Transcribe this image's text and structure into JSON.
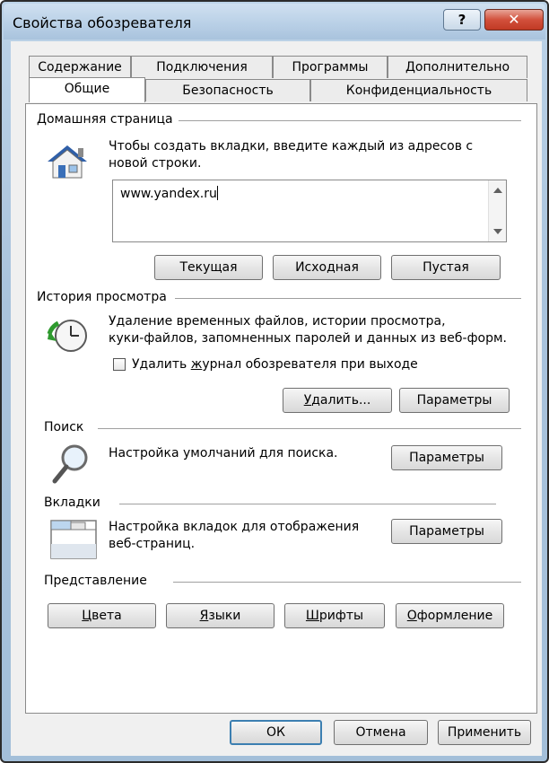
{
  "window": {
    "title": "Свойства обозревателя",
    "help_label": "?",
    "close_label": "✕"
  },
  "tabs": {
    "row_back": [
      "Содержание",
      "Подключения",
      "Программы",
      "Дополнительно"
    ],
    "row_front": [
      "Общие",
      "Безопасность",
      "Конфиденциальность"
    ],
    "active": "Общие"
  },
  "home": {
    "label": "Домашняя страница",
    "desc_1": "Чтобы создать вкладки, введите каждый из адресов с",
    "desc_2": "новой строки.",
    "url": "www.yandex.ru",
    "buttons": [
      "Текущая",
      "Исходная",
      "Пустая"
    ]
  },
  "history": {
    "label": "История просмотра",
    "desc_1": "Удаление временных файлов, истории просмотра,",
    "desc_2": "куки-файлов, запомненных паролей и данных из веб-форм.",
    "checkbox_pre": "Удалить ",
    "checkbox_u": "ж",
    "checkbox_post": "урнал обозревателя при выходе",
    "checkbox_checked": false,
    "delete_u": "У",
    "delete_rest": "далить...",
    "params_label": "Параметры"
  },
  "search": {
    "label": "Поиск",
    "desc": "Настройка умолчаний для поиска.",
    "params_label": "Параметры"
  },
  "tabs_section": {
    "label": "Вкладки",
    "desc_1": "Настройка вкладок для отображения",
    "desc_2": "веб-страниц.",
    "params_label": "Параметры"
  },
  "appearance": {
    "label": "Представление",
    "colors_u": "Ц",
    "colors_rest": "вета",
    "languages_u": "Я",
    "languages_rest": "зыки",
    "fonts_u": "Ш",
    "fonts_rest": "рифты",
    "accessibility_u": "О",
    "accessibility_rest": "формление"
  },
  "footer": {
    "ok": "ОК",
    "cancel": "Отмена",
    "apply_pre": "Применить",
    "apply_u": "",
    "apply_post": ""
  },
  "colors": {
    "accent": "#3c7fb1",
    "close": "#c13a24"
  }
}
